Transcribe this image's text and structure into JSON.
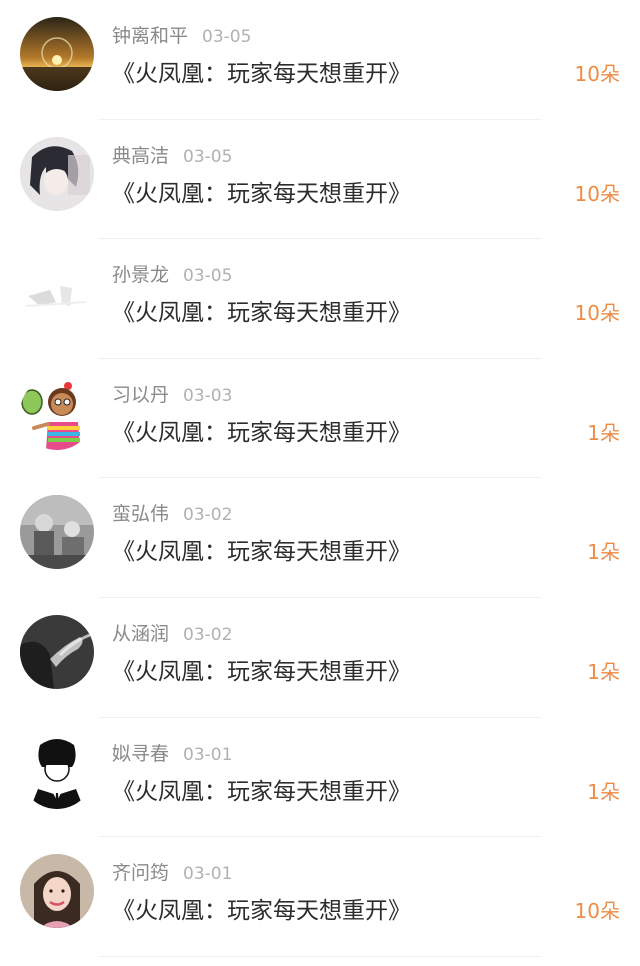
{
  "list": {
    "items": [
      {
        "name": "钟离和平",
        "date": "03-05",
        "title": "《火凤凰：玩家每天想重开》",
        "count": "10朵",
        "avatar": "sunset-lightbulb-avatar"
      },
      {
        "name": "典高洁",
        "date": "03-05",
        "title": "《火凤凰：玩家每天想重开》",
        "count": "10朵",
        "avatar": "anime-girl-avatar"
      },
      {
        "name": "孙景龙",
        "date": "03-05",
        "title": "《火凤凰：玩家每天想重开》",
        "count": "10朵",
        "avatar": "pale-sketch-avatar"
      },
      {
        "name": "习以丹",
        "date": "03-03",
        "title": "《火凤凰：玩家每天想重开》",
        "count": "1朵",
        "avatar": "cartoon-girl-avatar"
      },
      {
        "name": "蛮弘伟",
        "date": "03-02",
        "title": "《火凤凰：玩家每天想重开》",
        "count": "1朵",
        "avatar": "bw-kids-photo-avatar"
      },
      {
        "name": "从涵润",
        "date": "03-02",
        "title": "《火凤凰：玩家每天想重开》",
        "count": "1朵",
        "avatar": "bw-smoke-photo-avatar"
      },
      {
        "name": "姒寻春",
        "date": "03-01",
        "title": "《火凤凰：玩家每天想重开》",
        "count": "1朵",
        "avatar": "manga-boy-avatar"
      },
      {
        "name": "齐问筠",
        "date": "03-01",
        "title": "《火凤凰：玩家每天想重开》",
        "count": "10朵",
        "avatar": "woman-portrait-avatar"
      }
    ]
  },
  "colors": {
    "background": "#ffffff",
    "name_text": "#8a8a8a",
    "date_text": "#b1b1b1",
    "title_text": "#2d2d2d",
    "count_text": "#ee8b44",
    "divider": "#f1f1f1"
  }
}
